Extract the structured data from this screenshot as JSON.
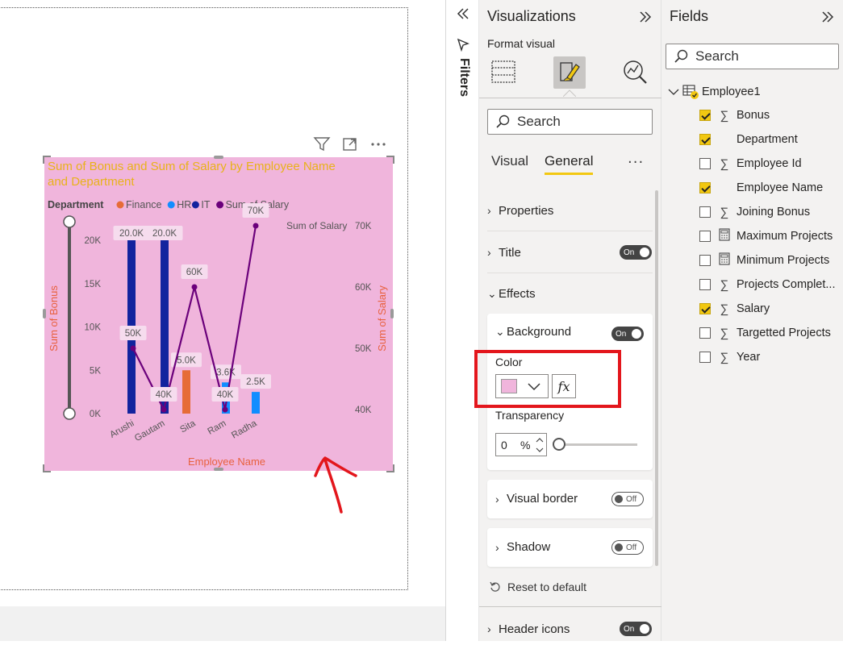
{
  "visual_header": {
    "filter_icon": "filter-icon",
    "focus_icon": "focus-mode-icon",
    "more_icon": "more-options-icon"
  },
  "chart_data": {
    "type": "bar",
    "title": "Sum of Bonus and Sum of Salary by Employee Name and Department",
    "title_line1": "Sum of Bonus and Sum of Salary by Employee Name",
    "title_line2": "and Department",
    "title_color": "#e8b21a",
    "background": "#f0b5dc",
    "legend_title": "Department",
    "legend": [
      {
        "name": "Finance",
        "color": "#e66c37"
      },
      {
        "name": "HR",
        "color": "#118dff"
      },
      {
        "name": "IT",
        "color": "#12239e"
      },
      {
        "name": "Sum of Salary",
        "color": "#6b007b"
      }
    ],
    "xlabel": "Employee Name",
    "ylabel": "Sum of Bonus",
    "y2label": "Sum of Salary",
    "y2label_top": "Sum of Salary",
    "axis_label_color": "#e8613e",
    "categories": [
      "Arushi",
      "Gautam",
      "Sita",
      "Ram",
      "Radha"
    ],
    "y_ticks": [
      "0K",
      "5K",
      "10K",
      "15K",
      "20K"
    ],
    "y2_ticks": [
      "40K",
      "50K",
      "60K",
      "70K"
    ],
    "ylim": [
      0,
      20000
    ],
    "y2lim": [
      40000,
      70000
    ],
    "bars": [
      {
        "category": "Arushi",
        "department": "IT",
        "value": 20000,
        "label": "20.0K"
      },
      {
        "category": "Gautam",
        "department": "IT",
        "value": 20000,
        "label": "20.0K"
      },
      {
        "category": "Sita",
        "department": "Finance",
        "value": 5000,
        "label": "5.0K"
      },
      {
        "category": "Ram",
        "department": "HR",
        "value": 3600,
        "label": "3.6K"
      },
      {
        "category": "Radha",
        "department": "HR",
        "value": 2500,
        "label": "2.5K"
      }
    ],
    "line_points": [
      {
        "x": 0.0,
        "value": 50000,
        "label": "50K"
      },
      {
        "x": 1.0,
        "value": 40000,
        "label": "40K"
      },
      {
        "x": 2.0,
        "value": 60000,
        "label": "60K"
      },
      {
        "x": 3.0,
        "value": 40000,
        "label": "40K"
      },
      {
        "x": 4.0,
        "value": 70000,
        "label": "70K"
      }
    ]
  },
  "filters_pane": {
    "label": "Filters",
    "collapse_icon": "double-chevron-left-icon"
  },
  "viz_pane": {
    "title": "Visualizations",
    "format_visual": "Format visual",
    "search_placeholder": "Search",
    "tabs": [
      {
        "label": "Visual",
        "active": false
      },
      {
        "label": "General",
        "active": true
      }
    ],
    "more": "...",
    "sections": {
      "properties": "Properties",
      "title": "Title",
      "title_toggle": "On",
      "effects": "Effects",
      "background": "Background",
      "background_toggle": "On",
      "color_label": "Color",
      "color_value": "#f0b5dc",
      "fx": "fx",
      "transparency_label": "Transparency",
      "transparency_value": "0",
      "transparency_unit": "%",
      "visual_border": "Visual border",
      "visual_border_toggle": "Off",
      "shadow": "Shadow",
      "shadow_toggle": "Off",
      "reset": "Reset to default",
      "header_icons": "Header icons",
      "header_icons_toggle": "On"
    }
  },
  "fields_pane": {
    "title": "Fields",
    "search_placeholder": "Search",
    "table": "Employee1",
    "fields": [
      {
        "name": "Bonus",
        "checked": true,
        "icon": "sigma"
      },
      {
        "name": "Department",
        "checked": true,
        "icon": "none"
      },
      {
        "name": "Employee Id",
        "checked": false,
        "icon": "sigma"
      },
      {
        "name": "Employee Name",
        "checked": true,
        "icon": "none"
      },
      {
        "name": "Joining Bonus",
        "checked": false,
        "icon": "sigma"
      },
      {
        "name": "Maximum Projects",
        "checked": false,
        "icon": "calculator"
      },
      {
        "name": "Minimum Projects",
        "checked": false,
        "icon": "calculator"
      },
      {
        "name": "Projects Complet...",
        "checked": false,
        "icon": "sigma"
      },
      {
        "name": "Salary",
        "checked": true,
        "icon": "sigma"
      },
      {
        "name": "Targetted Projects",
        "checked": false,
        "icon": "sigma"
      },
      {
        "name": "Year",
        "checked": false,
        "icon": "sigma"
      }
    ]
  }
}
